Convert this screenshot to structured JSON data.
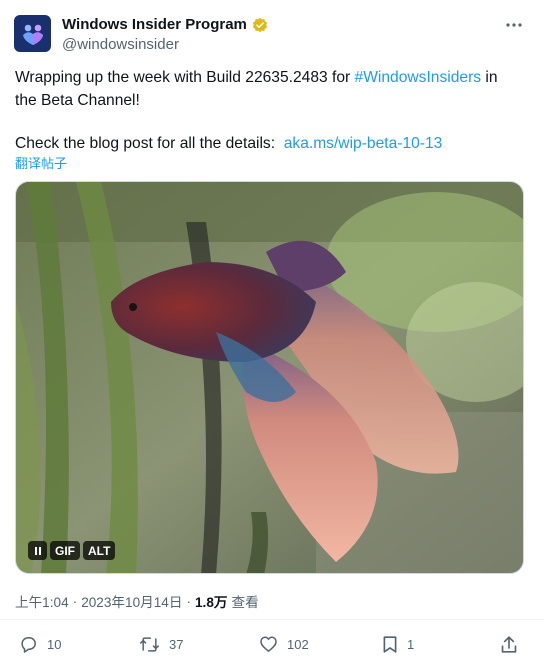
{
  "author": {
    "display_name": "Windows Insider Program",
    "handle": "@windowsinsider",
    "avatar_icon": "windows-insider-people-icon",
    "verified_color": "#e2b719"
  },
  "tweet": {
    "text_line1_prefix": "Wrapping up the week with Build 22635.2483 for ",
    "hashtag": "#WindowsInsiders",
    "text_line1_suffix": " in",
    "text_line2": "the Beta Channel!",
    "blog_prefix": "Check the blog post for all the details:  ",
    "blog_link": "aka.ms/wip-beta-10-13",
    "translate_label": "翻译帖子"
  },
  "media": {
    "pause_icon": "pause-icon",
    "gif_label": "GIF",
    "alt_label": "ALT"
  },
  "meta": {
    "time": "上午1:04",
    "separator1": "·",
    "date": "2023年10月14日",
    "separator2": "·",
    "views_count": "1.8万",
    "views_label": "查看"
  },
  "actions": {
    "replies": "10",
    "retweets": "37",
    "likes": "102",
    "bookmarks": "1"
  },
  "colors": {
    "link": "#1d9bf0",
    "muted": "#536471",
    "text": "#0f1419"
  }
}
